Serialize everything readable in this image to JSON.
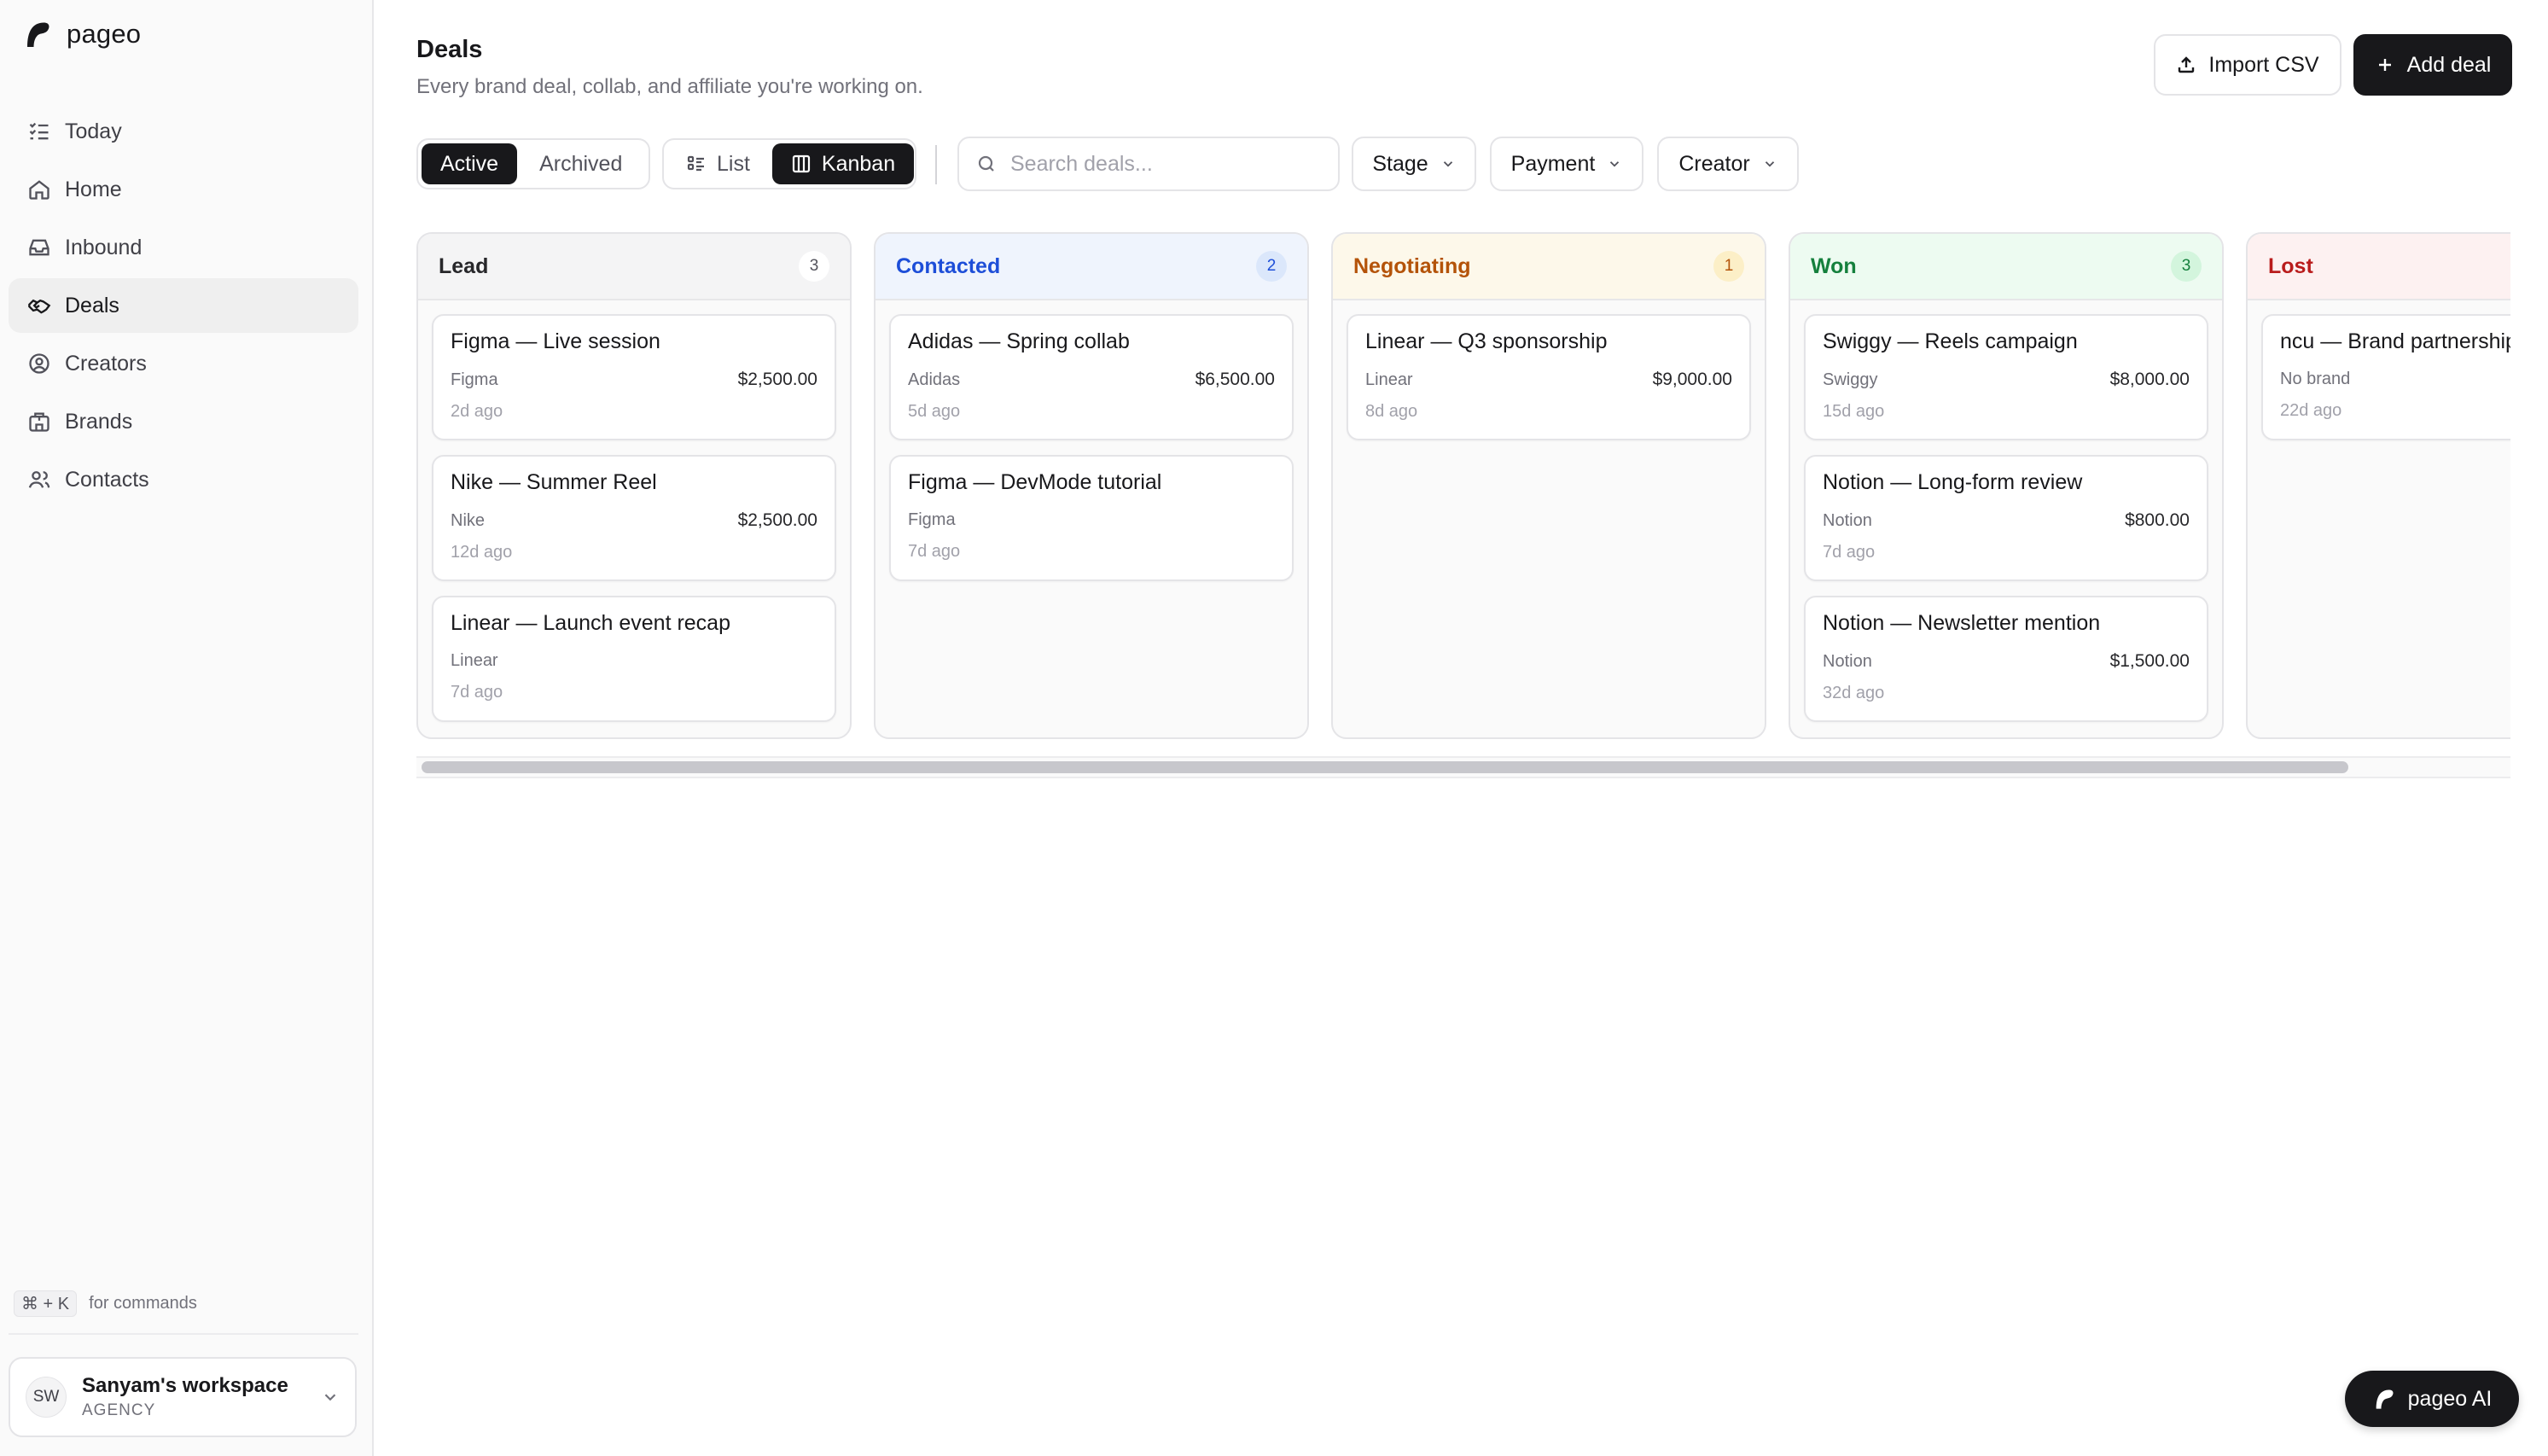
{
  "app": {
    "name": "pageo",
    "logo_icon": "pageo-logo-icon"
  },
  "sidebar": {
    "items": [
      {
        "label": "Today",
        "icon": "list-checks-icon",
        "active": false
      },
      {
        "label": "Home",
        "icon": "home-icon",
        "active": false
      },
      {
        "label": "Inbound",
        "icon": "inbox-icon",
        "active": false
      },
      {
        "label": "Deals",
        "icon": "handshake-icon",
        "active": true
      },
      {
        "label": "Creators",
        "icon": "user-circle-icon",
        "active": false
      },
      {
        "label": "Brands",
        "icon": "building-icon",
        "active": false
      },
      {
        "label": "Contacts",
        "icon": "users-icon",
        "active": false
      }
    ],
    "command_hint": {
      "keys": "⌘ + K",
      "text": "for commands"
    },
    "workspace": {
      "initials": "SW",
      "name": "Sanyam's workspace",
      "role": "AGENCY"
    }
  },
  "header": {
    "title": "Deals",
    "subtitle": "Every brand deal, collab, and affiliate you're working on.",
    "import_label": "Import CSV",
    "add_label": "Add deal"
  },
  "controls": {
    "status_tabs": [
      {
        "label": "Active",
        "active": true
      },
      {
        "label": "Archived",
        "active": false
      }
    ],
    "view_tabs": [
      {
        "label": "List",
        "active": false
      },
      {
        "label": "Kanban",
        "active": true
      }
    ],
    "search_placeholder": "Search deals...",
    "filters": [
      "Stage",
      "Payment",
      "Creator"
    ]
  },
  "board": {
    "columns": [
      {
        "title": "Lead",
        "count": "3",
        "title_color": "#27272a",
        "head_bg": "#f4f4f5",
        "count_bg": "#ffffff",
        "count_color": "#52525b",
        "cards": [
          {
            "title": "Figma — Live session",
            "brand": "Figma",
            "amount": "$2,500.00",
            "time": "2d ago"
          },
          {
            "title": "Nike — Summer Reel",
            "brand": "Nike",
            "amount": "$2,500.00",
            "time": "12d ago"
          },
          {
            "title": "Linear — Launch event recap",
            "brand": "Linear",
            "amount": "",
            "time": "7d ago"
          }
        ]
      },
      {
        "title": "Contacted",
        "count": "2",
        "title_color": "#1d4ed8",
        "head_bg": "#eff4fd",
        "count_bg": "#dbe7fb",
        "count_color": "#1d4ed8",
        "cards": [
          {
            "title": "Adidas — Spring collab",
            "brand": "Adidas",
            "amount": "$6,500.00",
            "time": "5d ago"
          },
          {
            "title": "Figma — DevMode tutorial",
            "brand": "Figma",
            "amount": "",
            "time": "7d ago"
          }
        ]
      },
      {
        "title": "Negotiating",
        "count": "1",
        "title_color": "#b45309",
        "head_bg": "#fdf8ea",
        "count_bg": "#fcefc7",
        "count_color": "#b45309",
        "cards": [
          {
            "title": "Linear — Q3 sponsorship",
            "brand": "Linear",
            "amount": "$9,000.00",
            "time": "8d ago"
          }
        ]
      },
      {
        "title": "Won",
        "count": "3",
        "title_color": "#15803d",
        "head_bg": "#edfbf1",
        "count_bg": "#d3f5dd",
        "count_color": "#15803d",
        "cards": [
          {
            "title": "Swiggy — Reels campaign",
            "brand": "Swiggy",
            "amount": "$8,000.00",
            "time": "15d ago"
          },
          {
            "title": "Notion — Long-form review",
            "brand": "Notion",
            "amount": "$800.00",
            "time": "7d ago"
          },
          {
            "title": "Notion — Newsletter mention",
            "brand": "Notion",
            "amount": "$1,500.00",
            "time": "32d ago"
          }
        ]
      },
      {
        "title": "Lost",
        "count": "",
        "title_color": "#b91c1c",
        "head_bg": "#fdf1f1",
        "count_bg": "#fbdcdc",
        "count_color": "#b91c1c",
        "cards": [
          {
            "title": "ncu — Brand partnership",
            "brand": "No brand",
            "amount": "",
            "time": "22d ago"
          }
        ]
      }
    ]
  },
  "assistant": {
    "label": "pageo AI"
  }
}
